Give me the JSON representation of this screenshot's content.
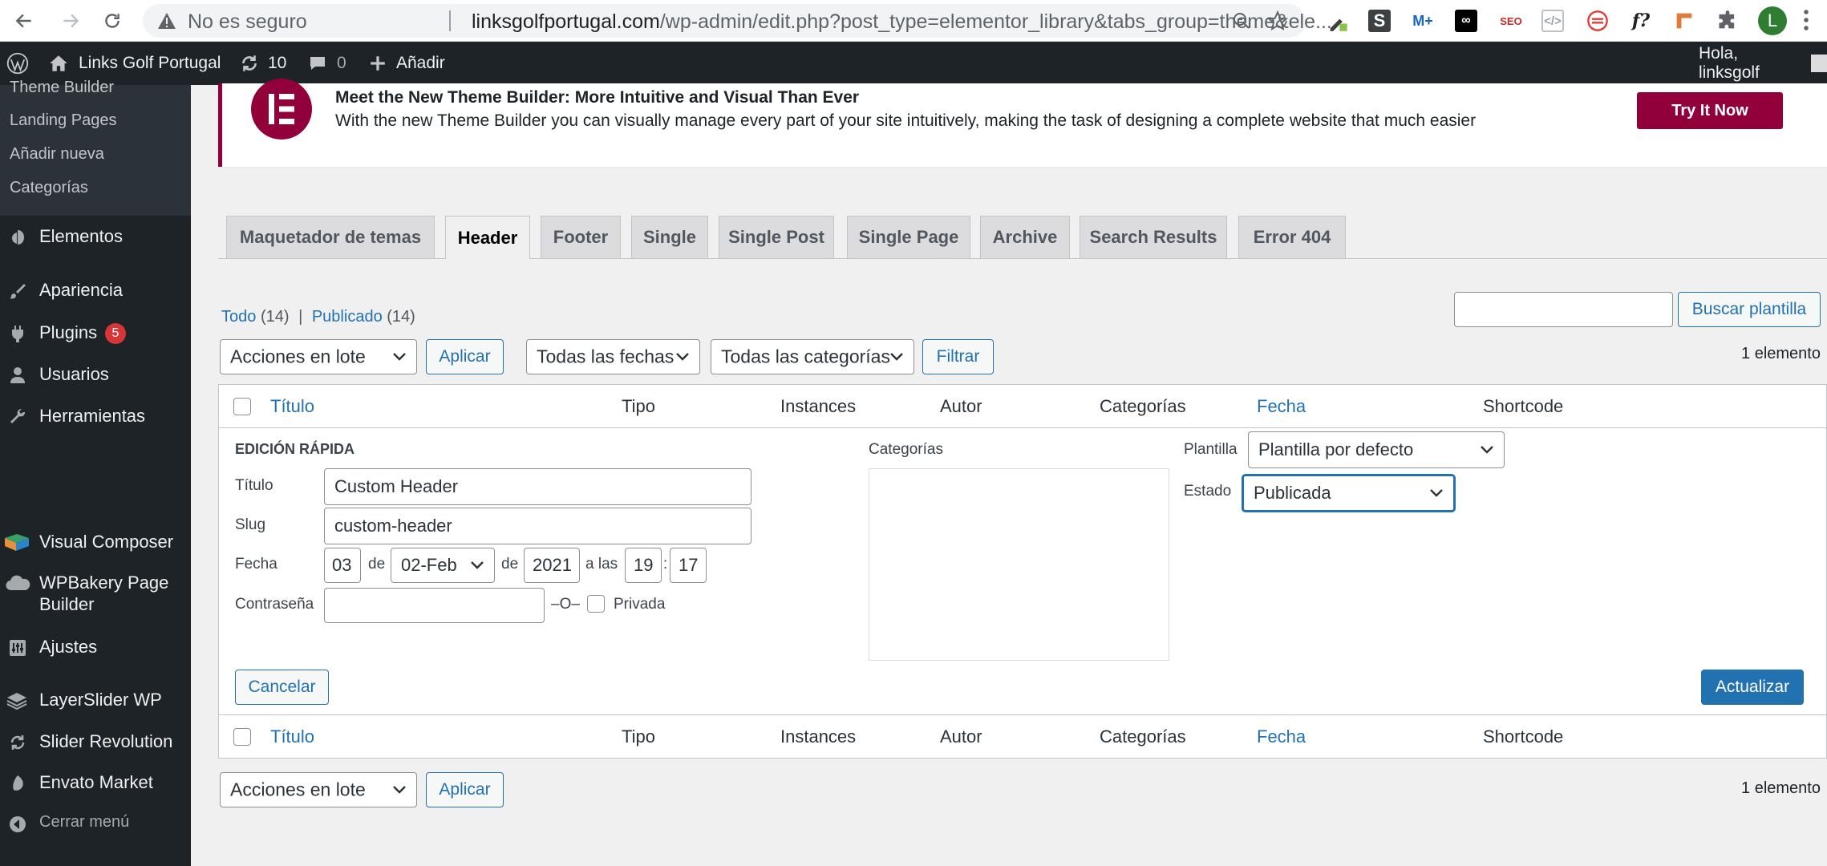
{
  "browser": {
    "insecure_label": "No es seguro",
    "url_host": "linksgolfportugal.com",
    "url_path": "/wp-admin/edit.php?post_type=elementor_library&tabs_group=theme&ele...",
    "profile_initial": "L",
    "profile_color": "#2e7d32"
  },
  "adminbar": {
    "site_name": "Links Golf Portugal",
    "updates_count": "10",
    "comments_count": "0",
    "add_new": "Añadir",
    "greeting": "Hola, linksgolf"
  },
  "sidebar": {
    "submenu": [
      "Theme Builder",
      "Landing Pages",
      "Añadir nueva",
      "Categorías"
    ],
    "items": [
      {
        "label": "Elementos",
        "icon": "elementor-icon"
      },
      {
        "label": "Apariencia",
        "icon": "paintbrush-icon"
      },
      {
        "label": "Plugins",
        "icon": "plugin-icon",
        "badge": "5"
      },
      {
        "label": "Usuarios",
        "icon": "users-icon"
      },
      {
        "label": "Herramientas",
        "icon": "wrench-icon"
      },
      {
        "label": "Visual Composer",
        "icon": "visual-composer-icon"
      },
      {
        "label": "WPBakery Page",
        "label2": "Builder",
        "icon": "wpbakery-icon"
      },
      {
        "label": "Ajustes",
        "icon": "settings-icon"
      },
      {
        "label": "LayerSlider WP",
        "icon": "layers-icon"
      },
      {
        "label": "Slider Revolution",
        "icon": "refresh-icon"
      },
      {
        "label": "Envato Market",
        "icon": "leaf-icon"
      },
      {
        "label": "Cerrar menú",
        "icon": "collapse-icon"
      }
    ]
  },
  "notice": {
    "title": "Meet the New Theme Builder: More Intuitive and Visual Than Ever",
    "body": "With the new Theme Builder you can visually manage every part of your site intuitively, making the task of designing a complete website that much easier",
    "button": "Try It Now",
    "brand_color": "#92003b"
  },
  "tabs": [
    "Maquetador de temas",
    "Header",
    "Footer",
    "Single",
    "Single Post",
    "Single Page",
    "Archive",
    "Search Results",
    "Error 404"
  ],
  "filters": {
    "all_label": "Todo",
    "all_count": "(14)",
    "separator": "|",
    "published_label": "Publicado",
    "published_count": "(14)",
    "search_button": "Buscar plantilla",
    "bulk_actions": "Acciones en lote",
    "apply": "Aplicar",
    "all_dates": "Todas las fechas",
    "all_categories": "Todas las categorías",
    "filter": "Filtrar",
    "count": "1 elemento"
  },
  "table": {
    "headers": [
      "Título",
      "Tipo",
      "Instances",
      "Autor",
      "Categorías",
      "Fecha",
      "Shortcode"
    ]
  },
  "quick_edit": {
    "heading": "EDICIÓN RÁPIDA",
    "title_label": "Título",
    "title_value": "Custom Header",
    "slug_label": "Slug",
    "slug_value": "custom-header",
    "date_label": "Fecha",
    "day": "03",
    "de1": "de",
    "month": "02-Feb",
    "de2": "de",
    "year": "2021",
    "at": "a las",
    "hour": "19",
    "colon": ":",
    "minute": "17",
    "password_label": "Contraseña",
    "or": "–O–",
    "private_label": "Privada",
    "categories_label": "Categorías",
    "template_label": "Plantilla",
    "template_value": "Plantilla por defecto",
    "status_label": "Estado",
    "status_value": "Publicada",
    "cancel": "Cancelar",
    "update": "Actualizar"
  }
}
